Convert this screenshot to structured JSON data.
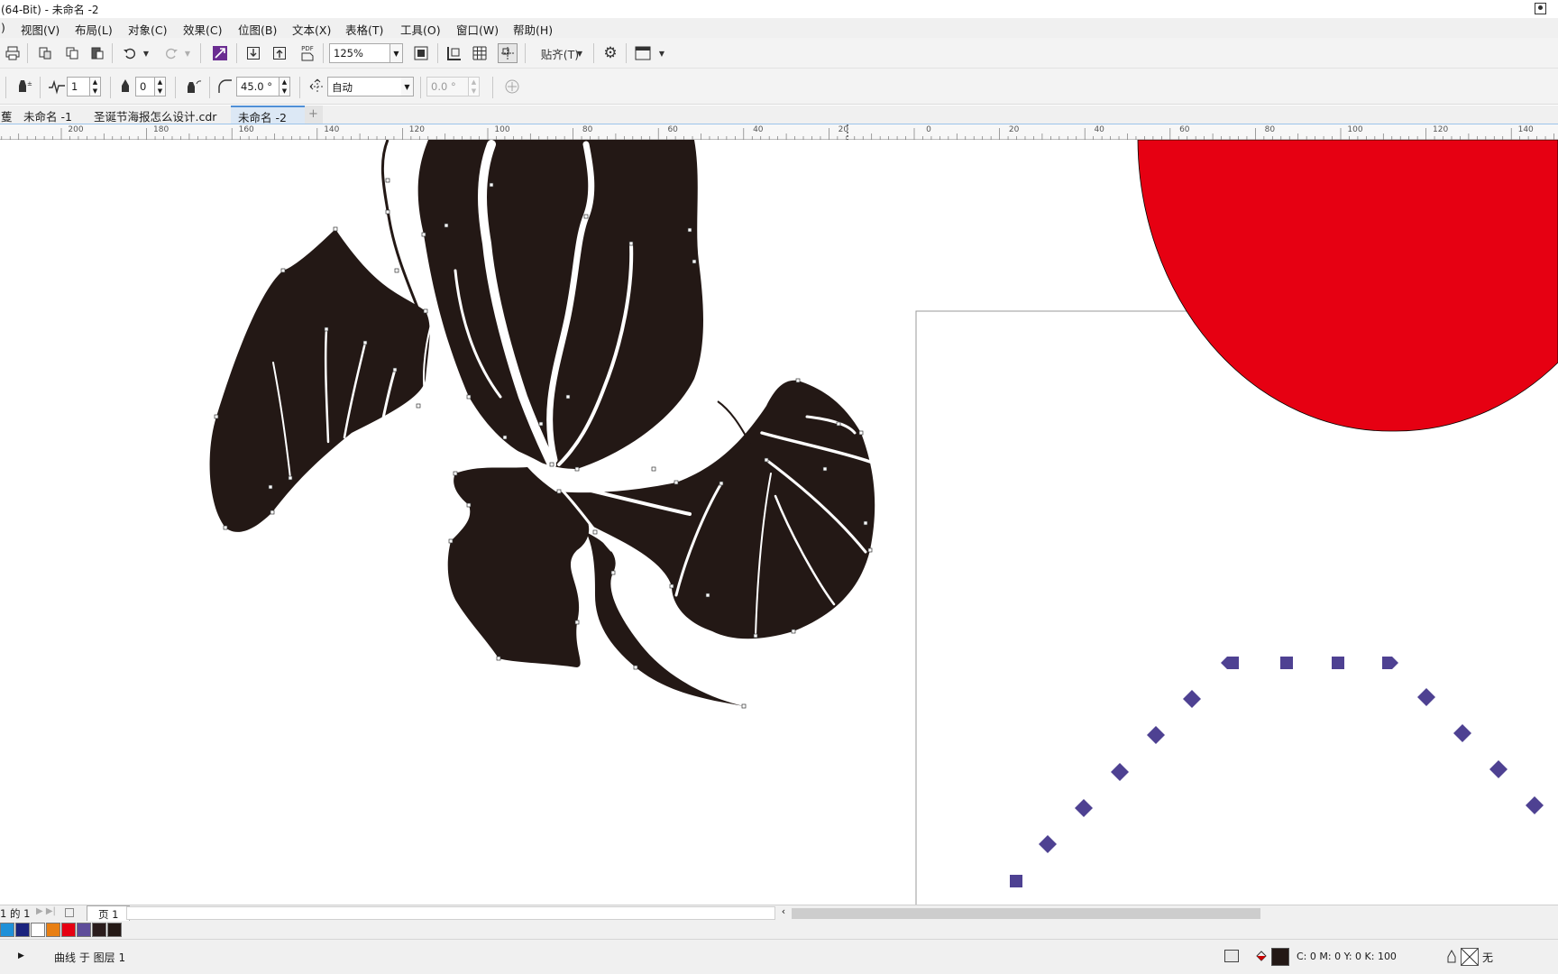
{
  "window": {
    "title": "(64-Bit) - 未命名 -2"
  },
  "menu": [
    "视图(V)",
    "布局(L)",
    "对象(C)",
    "效果(C)",
    "位图(B)",
    "文本(X)",
    "表格(T)",
    "工具(O)",
    "窗口(W)",
    "帮助(H)"
  ],
  "toolbar": {
    "zoom_value": "125%",
    "pdf_label": "PDF",
    "snap_label": "贴齐(T)"
  },
  "property_bar": {
    "smooth_value": "1",
    "outline_value": "0",
    "angle_value": "45.0 °",
    "auto_mode": "自动",
    "rotation_value": "0.0 °"
  },
  "doc_tabs": [
    {
      "label": "未命名 -1",
      "active": false
    },
    {
      "label": "圣诞节海报怎么设计.cdr",
      "active": false
    },
    {
      "label": "未命名 -2",
      "active": true
    }
  ],
  "tabs_leading_fragment": "蒦",
  "ruler_labels": [
    "200",
    "180",
    "160",
    "140",
    "120",
    "100",
    "80",
    "60",
    "40",
    "20",
    "0",
    "20",
    "40",
    "60",
    "80",
    "100",
    "120",
    "140"
  ],
  "page_nav": {
    "counter": "1 的 1",
    "page_tab": "页 1"
  },
  "palette_colors": [
    "#1e90d8",
    "#1a237e",
    "#ffffff",
    "#e87f13",
    "#e60012",
    "#5e4d9a",
    "#2a1c1c",
    "#231815"
  ],
  "colors": {
    "shape_black": "#231815",
    "red_ellipse": "#e60012",
    "diamond_purple": "#4e4192",
    "node_fill": "#ffffff"
  },
  "status": {
    "selection_info": "曲线 于 图层 1",
    "fill_info": "C: 0 M: 0 Y: 0 K: 100",
    "outline_info": "无"
  },
  "icons": {
    "undo": "undo-icon",
    "redo": "redo-icon",
    "settings": "gear-icon",
    "import": "import-icon",
    "export": "export-icon",
    "fullscreen": "fullscreen-icon"
  }
}
